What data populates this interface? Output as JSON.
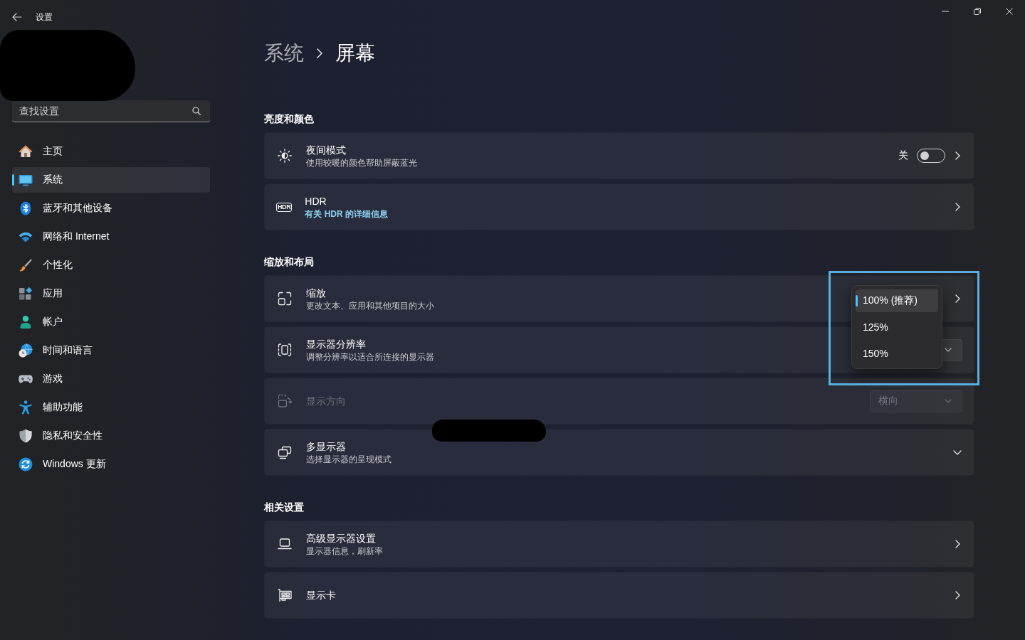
{
  "window": {
    "title": "设置"
  },
  "sidebar": {
    "search": {
      "placeholder": "查找设置"
    },
    "items": [
      {
        "label": "主页",
        "selected": false
      },
      {
        "label": "系统",
        "selected": true
      },
      {
        "label": "蓝牙和其他设备",
        "selected": false
      },
      {
        "label": "网络和 Internet",
        "selected": false
      },
      {
        "label": "个性化",
        "selected": false
      },
      {
        "label": "应用",
        "selected": false
      },
      {
        "label": "帐户",
        "selected": false
      },
      {
        "label": "时间和语言",
        "selected": false
      },
      {
        "label": "游戏",
        "selected": false
      },
      {
        "label": "辅助功能",
        "selected": false
      },
      {
        "label": "隐私和安全性",
        "selected": false
      },
      {
        "label": "Windows 更新",
        "selected": false
      }
    ]
  },
  "breadcrumb": [
    "系统",
    "屏幕"
  ],
  "sections": [
    {
      "heading": "亮度和颜色",
      "rows": [
        {
          "kind": "toggle",
          "title": "夜间模式",
          "subtitle": "使用较暖的颜色帮助屏蔽蓝光",
          "toggle_label": "关",
          "on": false,
          "disabled": false,
          "highlighted": false
        },
        {
          "kind": "link",
          "badge": "HDR",
          "title": "HDR",
          "link": "有关 HDR 的详细信息",
          "disabled": false,
          "highlighted": false
        }
      ]
    },
    {
      "heading": "缩放和布局",
      "rows": [
        {
          "kind": "dropdown_open",
          "title": "缩放",
          "subtitle": "更改文本、应用和其他项目的大小",
          "options": [
            {
              "label": "100% (推荐)",
              "selected": true
            },
            {
              "label": "125%",
              "selected": false
            },
            {
              "label": "150%",
              "selected": false
            }
          ],
          "disabled": false,
          "highlighted": true
        },
        {
          "kind": "dropdown",
          "title": "显示器分辨率",
          "subtitle": "调整分辨率以适合所连接的显示器",
          "disabled": false,
          "highlighted": false
        },
        {
          "kind": "dropdown",
          "title": "显示方向",
          "value": "横向",
          "disabled": true,
          "highlighted": false
        },
        {
          "kind": "expander",
          "title": "多显示器",
          "subtitle": "选择显示器的呈现模式",
          "expanded": false,
          "disabled": false,
          "highlighted": false
        }
      ]
    },
    {
      "heading": "相关设置",
      "rows": [
        {
          "kind": "nav",
          "title": "高级显示器设置",
          "subtitle": "显示器信息，刷新率",
          "disabled": false,
          "highlighted": false
        },
        {
          "kind": "nav",
          "title": "显示卡",
          "disabled": false,
          "highlighted": false
        }
      ]
    }
  ]
}
